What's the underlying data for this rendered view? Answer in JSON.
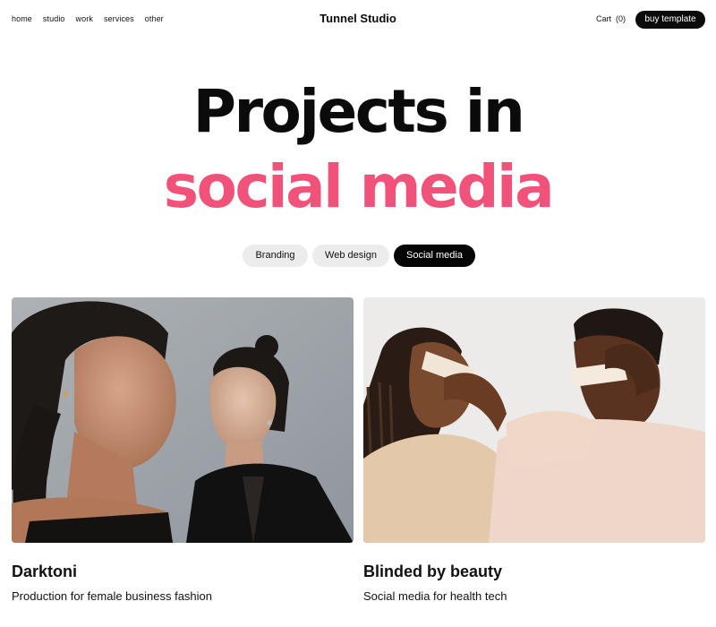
{
  "nav": {
    "links": [
      "home",
      "studio",
      "work",
      "services",
      "other"
    ],
    "brand": "Tunnel Studio",
    "cart": "Cart  (0)",
    "cta": "buy template"
  },
  "hero": {
    "line1": "Projects in",
    "line2": "social media",
    "accent_color": "#f0527a"
  },
  "filters": {
    "items": [
      "Branding",
      "Web design",
      "Social media"
    ],
    "active": "Social media"
  },
  "projects": [
    {
      "title": "Darktoni",
      "subtitle": "Production for female business fashion",
      "image": "portrait-photo-two-women"
    },
    {
      "title": "Blinded by beauty",
      "subtitle": "Social media for health tech",
      "image": "photo-two-people-covering-eyes"
    }
  ]
}
